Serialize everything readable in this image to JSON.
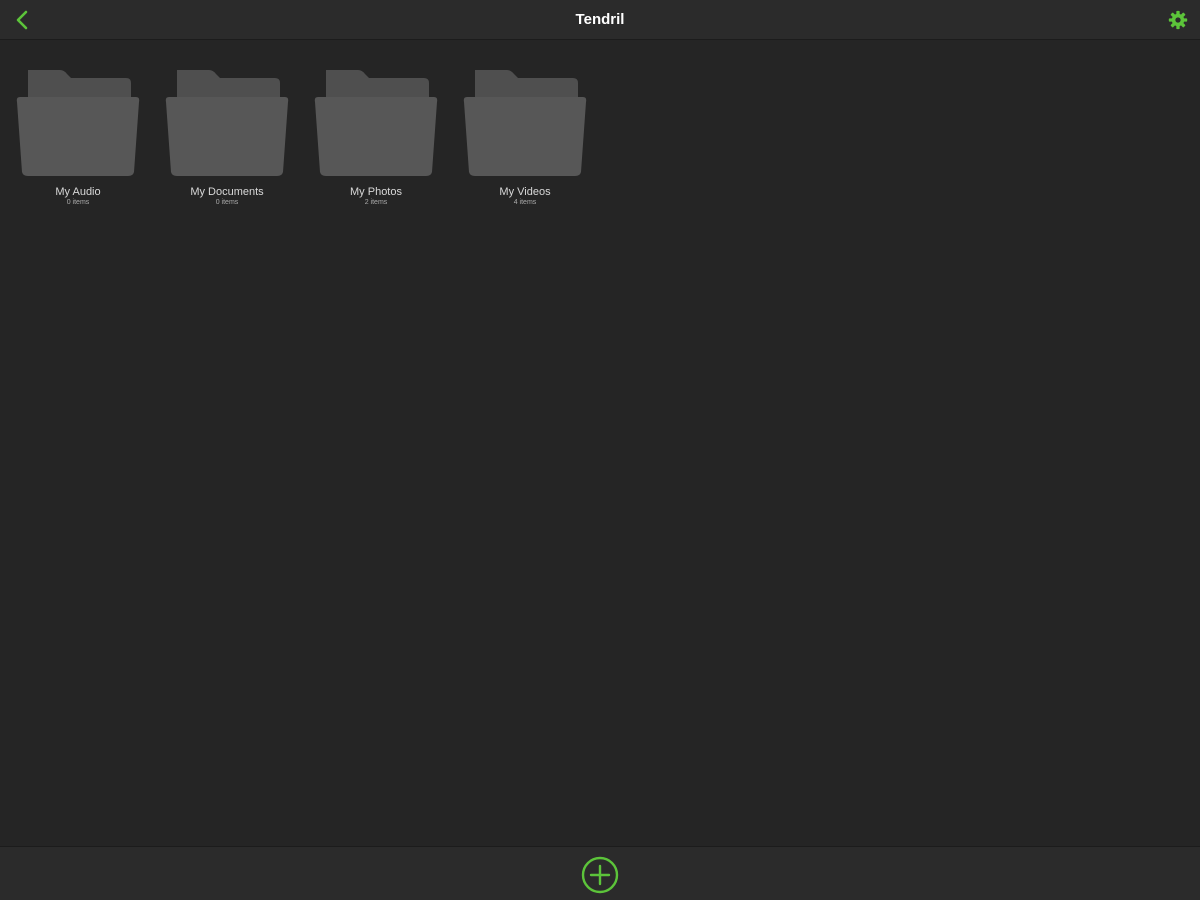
{
  "header": {
    "title": "Tendril",
    "back_icon": "chevron-left-icon",
    "settings_icon": "gear-icon"
  },
  "folders": [
    {
      "name": "My Audio",
      "count": "0 items"
    },
    {
      "name": "My Documents",
      "count": "0 items"
    },
    {
      "name": "My Photos",
      "count": "2 items"
    },
    {
      "name": "My Videos",
      "count": "4 items"
    }
  ],
  "footer": {
    "add_icon": "plus-circle-icon"
  },
  "colors": {
    "accent": "#5cc43a",
    "background": "#252525",
    "bar": "#2b2b2b",
    "folder": "#575757",
    "folder_tab": "#4f4f4f"
  }
}
